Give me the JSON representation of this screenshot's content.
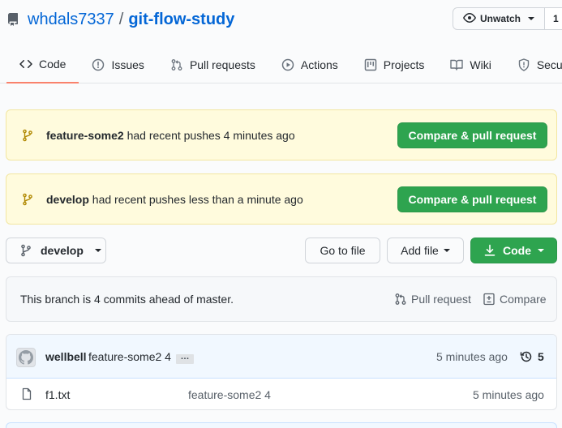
{
  "repo": {
    "owner": "whdals7337",
    "separator": "/",
    "name": "git-flow-study",
    "icon": "repo-icon"
  },
  "watch": {
    "label": "Unwatch",
    "count": "1",
    "icon": "eye-icon"
  },
  "tabs": [
    {
      "label": "Code",
      "icon": "code-icon",
      "selected": true
    },
    {
      "label": "Issues",
      "icon": "issue-icon"
    },
    {
      "label": "Pull requests",
      "icon": "pull-request-icon"
    },
    {
      "label": "Actions",
      "icon": "play-icon"
    },
    {
      "label": "Projects",
      "icon": "project-icon"
    },
    {
      "label": "Wiki",
      "icon": "book-icon"
    },
    {
      "label": "Security",
      "icon": "shield-icon"
    }
  ],
  "flashes": [
    {
      "branch": "feature-some2",
      "text": "had recent pushes 4 minutes ago",
      "button": "Compare & pull request"
    },
    {
      "branch": "develop",
      "text": "had recent pushes less than a minute ago",
      "button": "Compare & pull request"
    }
  ],
  "toolbar": {
    "branch": "develop",
    "go_to_file": "Go to file",
    "add_file": "Add file",
    "code": "Code"
  },
  "ahead": {
    "text": "This branch is 4 commits ahead of master.",
    "pull_request": "Pull request",
    "compare": "Compare"
  },
  "latest_commit": {
    "author": "wellbell",
    "message": "feature-some2 4",
    "ellipsis": "…",
    "time": "5 minutes ago",
    "history_count": "5"
  },
  "files": [
    {
      "name": "f1.txt",
      "commit": "feature-some2 4",
      "time": "5 minutes ago"
    }
  ],
  "colors": {
    "accent": "#0366d6",
    "green": "#2ea44f",
    "flash_bg": "#fffbdd",
    "tab_underline": "#f9826c"
  }
}
